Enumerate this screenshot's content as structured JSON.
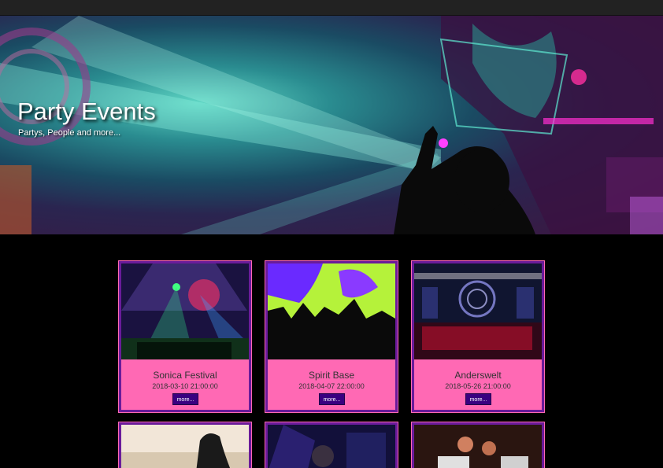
{
  "hero": {
    "title": "Party Events",
    "subtitle": "Partys, People and more..."
  },
  "events": [
    {
      "name": "Sonica Festival",
      "date": "2018-03-10 21:00:00",
      "button": "more..."
    },
    {
      "name": "Spirit Base",
      "date": "2018-04-07 22:00:00",
      "button": "more..."
    },
    {
      "name": "Anderswelt",
      "date": "2018-05-26 21:00:00",
      "button": "more..."
    }
  ],
  "colors": {
    "card_bg": "#ff69b4",
    "card_border": "#6a1b9a",
    "button_bg": "#3a0080",
    "page_bg": "#000000"
  }
}
